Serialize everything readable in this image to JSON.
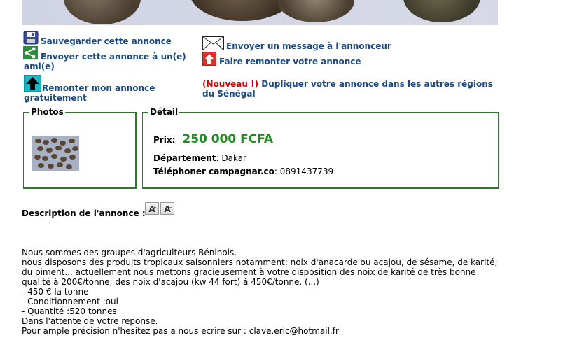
{
  "actions": {
    "save": "Sauvegarder cette annonce",
    "send_friend": "Envoyer cette annonce à un(e) ami(e)",
    "bump_free": "Remonter mon annonce gratuitement",
    "message_advertiser": "Envoyer un message à l'annonceur",
    "bump_paid": "Faire remonter votre annonce",
    "new_tag": "(Nouveau !)",
    "duplicate": "Dupliquer votre annonce dans les autres régions du Sénégal"
  },
  "photos": {
    "title": "Photos"
  },
  "detail": {
    "title": "Détail",
    "price_label": "Prix:",
    "price_value": "250 000 FCFA",
    "department_label": "Département",
    "department_value": ": Dakar",
    "phone_label": "Téléphoner campagnar.co",
    "phone_value": ": 0891437739"
  },
  "description": {
    "title": "Description de l'annonce :",
    "font_increase": "A",
    "font_decrease": "A",
    "lines": [
      "Nous sommes des groupes d'agriculteurs Béninois.",
      "nous disposons des produits tropicaux saisonniers notamment: noix d'anacarde ou acajou, de sésame, de karité; du piment... actuellement nous mettons gracieusement à votre disposition des noix de karité de très bonne qualité à 200€/tonne; des noix d'acajou (kw 44 fort) à 450€/tonne. (...)",
      "- 450 € la tonne",
      "- Conditionnement :oui",
      "- Quantité :520 tonnes",
      "Dans l'attente de votre reponse.",
      "Pour ample précision n'hesitez pas a nous ecrire sur : clave.eric@hotmail.fr"
    ]
  },
  "colors": {
    "link": "#1a4a86",
    "price": "#228b22",
    "border": "#2d7a2d",
    "new_tag": "#cc0000"
  }
}
